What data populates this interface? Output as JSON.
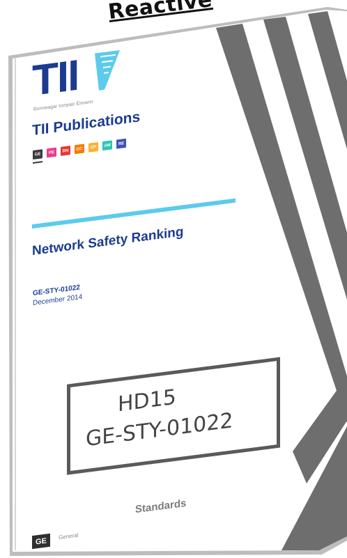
{
  "banner": "Reactive",
  "logo": {
    "letters": "TII",
    "tagline": "Bonneagar Iompair Éireann",
    "icon": "harp-icon"
  },
  "series_title": "TII Publications",
  "category_chips": [
    {
      "code": "GE",
      "color": "#3a3a3a"
    },
    {
      "code": "PE",
      "color": "#e83e8c"
    },
    {
      "code": "DN",
      "color": "#e53935"
    },
    {
      "code": "CC",
      "color": "#f57c00"
    },
    {
      "code": "CP",
      "color": "#f9b233"
    },
    {
      "code": "AM",
      "color": "#2ec4b6"
    },
    {
      "code": "RE",
      "color": "#3f51b5"
    }
  ],
  "document": {
    "title": "Network Safety Ranking",
    "code": "GE-STY-01022",
    "date": "December 2014"
  },
  "stamp": {
    "line1": "HD15",
    "line2": "GE-STY-01022"
  },
  "footer": {
    "section": "Standards",
    "category_code": "GE",
    "category_name": "General"
  },
  "colors": {
    "brand_blue": "#1b3c8e",
    "accent_cyan": "#5ccbec",
    "stripe_grey": "#6e6e6e"
  }
}
